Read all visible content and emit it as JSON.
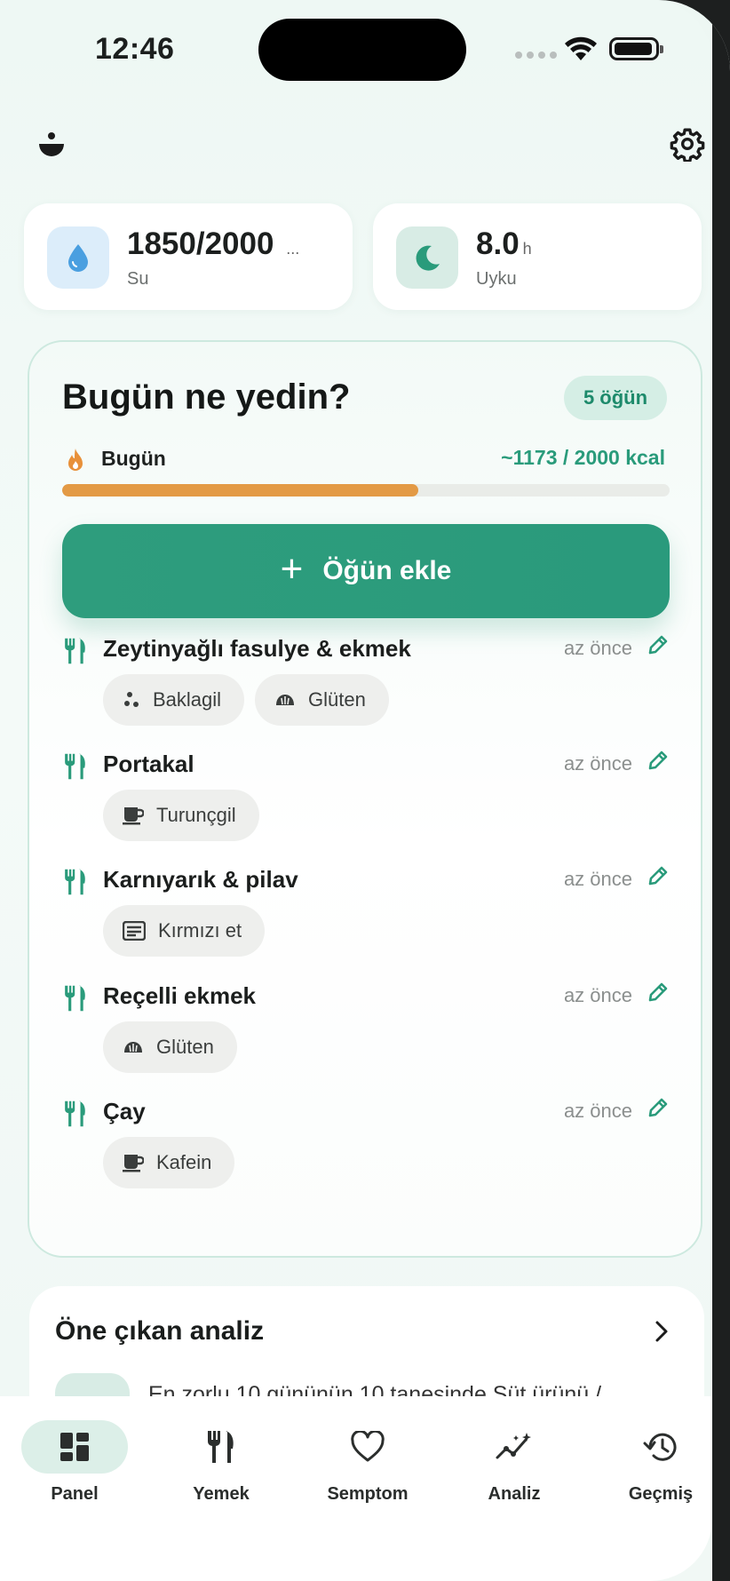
{
  "status_bar": {
    "time": "12:46"
  },
  "stats": {
    "water": {
      "value": "1850/2000",
      "ellipsis": "...",
      "label": "Su",
      "icon": "water-drop-icon"
    },
    "sleep": {
      "value": "8.0",
      "unit": "h",
      "label": "Uyku",
      "icon": "moon-icon"
    }
  },
  "main": {
    "title": "Bugün ne yedin?",
    "meal_count": "5 öğün",
    "today_label": "Bugün",
    "kcal": "~1173 / 2000 kcal",
    "kcal_progress": 0.5865,
    "add_button": {
      "plus": "+",
      "label": "Öğün ekle"
    },
    "meals": [
      {
        "name": "Zeytinyağlı fasulye & ekmek",
        "time": "az önce",
        "tags": [
          {
            "label": "Baklagil",
            "icon": "legume-icon"
          },
          {
            "label": "Glüten",
            "icon": "bread-icon"
          }
        ]
      },
      {
        "name": "Portakal",
        "time": "az önce",
        "tags": [
          {
            "label": "Turunçgil",
            "icon": "citrus-icon"
          }
        ]
      },
      {
        "name": "Karnıyarık & pilav",
        "time": "az önce",
        "tags": [
          {
            "label": "Kırmızı et",
            "icon": "meat-icon"
          }
        ]
      },
      {
        "name": "Reçelli ekmek",
        "time": "az önce",
        "tags": [
          {
            "label": "Glüten",
            "icon": "bread-icon"
          }
        ]
      },
      {
        "name": "Çay",
        "time": "az önce",
        "tags": [
          {
            "label": "Kafein",
            "icon": "cup-icon"
          }
        ]
      }
    ]
  },
  "analysis": {
    "title": "Öne çıkan analiz",
    "text": "En zorlu 10 gününün 10 tanesinde Süt ürünü /"
  },
  "tabs": [
    {
      "label": "Panel",
      "icon": "dashboard-icon",
      "active": true
    },
    {
      "label": "Yemek",
      "icon": "fork-knife-icon",
      "active": false
    },
    {
      "label": "Semptom",
      "icon": "heart-icon",
      "active": false
    },
    {
      "label": "Analiz",
      "icon": "trend-icon",
      "active": false
    },
    {
      "label": "Geçmiş",
      "icon": "history-icon",
      "active": false
    }
  ],
  "colors": {
    "accent": "#2a9b7b",
    "progress": "#e39a45",
    "water": "#4a9fe0"
  }
}
